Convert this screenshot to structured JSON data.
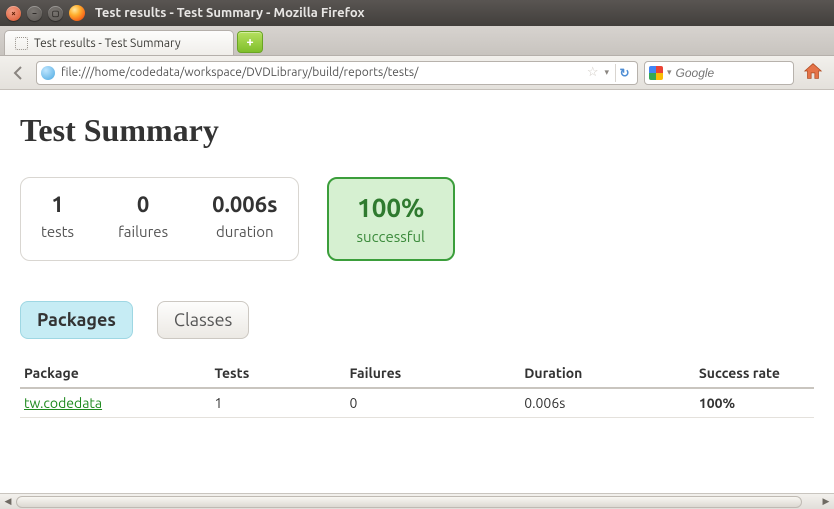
{
  "window": {
    "title": "Test results - Test Summary - Mozilla Firefox"
  },
  "tab": {
    "title": "Test results - Test Summary"
  },
  "urlbar": {
    "url": "file:///home/codedata/workspace/DVDLibrary/build/reports/tests/"
  },
  "search": {
    "placeholder": "Google"
  },
  "report": {
    "title": "Test Summary",
    "stats": {
      "tests": {
        "value": "1",
        "label": "tests"
      },
      "failures": {
        "value": "0",
        "label": "failures"
      },
      "duration": {
        "value": "0.006s",
        "label": "duration"
      }
    },
    "success": {
      "percent": "100%",
      "label": "successful"
    },
    "tabs": {
      "packages": "Packages",
      "classes": "Classes"
    },
    "table": {
      "headers": {
        "package": "Package",
        "tests": "Tests",
        "failures": "Failures",
        "duration": "Duration",
        "rate": "Success rate"
      },
      "rows": [
        {
          "package": "tw.codedata",
          "tests": "1",
          "failures": "0",
          "duration": "0.006s",
          "rate": "100%"
        }
      ]
    }
  }
}
